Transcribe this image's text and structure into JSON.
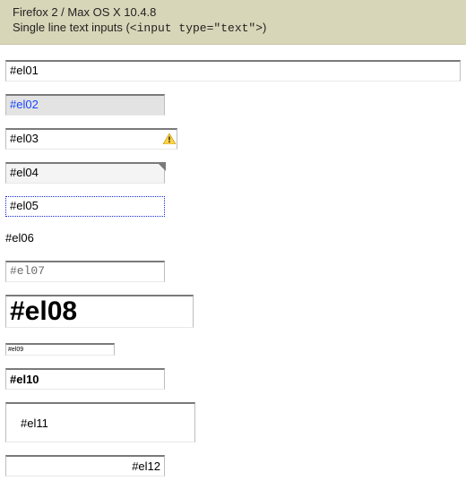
{
  "header": {
    "env": "Firefox 2 / Max OS X 10.4.8",
    "desc_prefix": "Single line text inputs (",
    "desc_code": "<input type=\"text\">",
    "desc_suffix": ")"
  },
  "inputs": {
    "el01": "#el01",
    "el02": "#el02",
    "el03": "#el03",
    "el04": "#el04",
    "el05": "#el05",
    "el06": "#el06",
    "el07": "#el07",
    "el08": "#el08",
    "el09": "#el09",
    "el10": "#el10",
    "el11": "#el11",
    "el12": "#el12"
  },
  "icons": {
    "warning": "warning-icon"
  }
}
